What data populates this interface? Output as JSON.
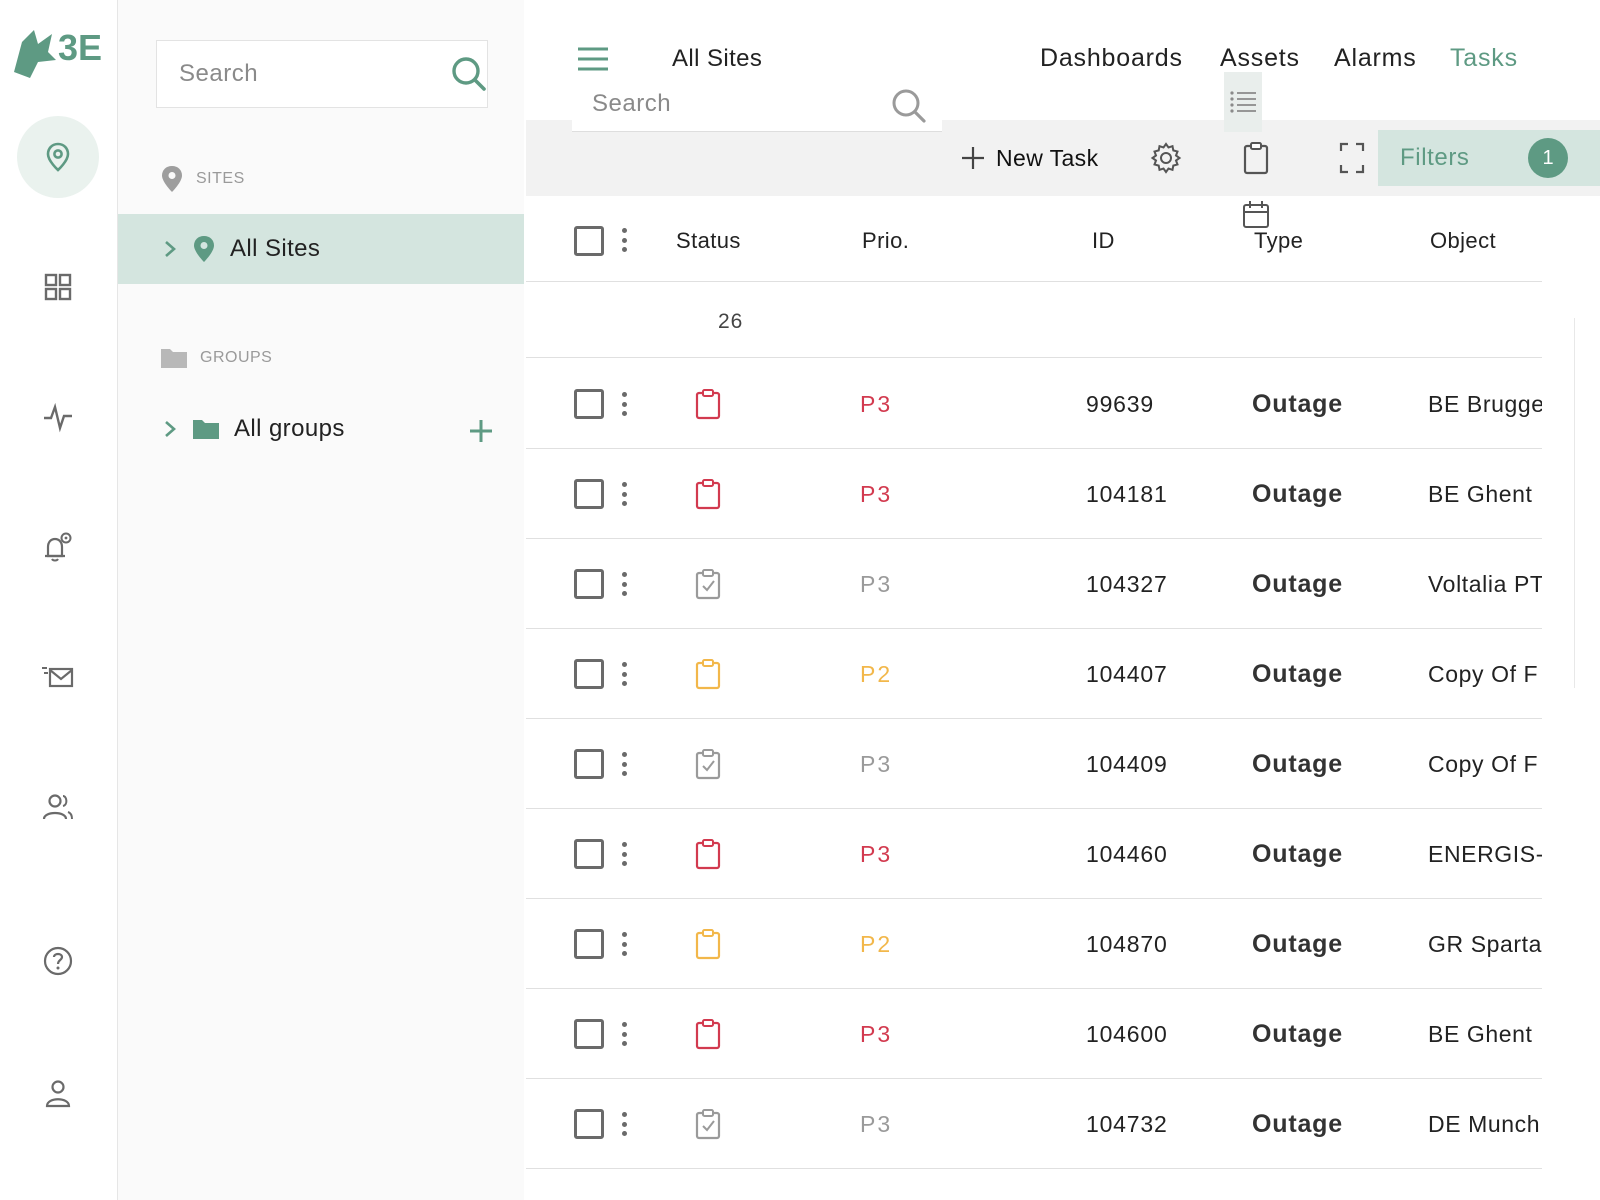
{
  "brand": {
    "logo_text": "3E",
    "color": "#5e9a83"
  },
  "rail": {
    "items": [
      {
        "name": "sites",
        "icon": "map-pin-icon",
        "active": true
      },
      {
        "name": "dashboards",
        "icon": "grid-icon"
      },
      {
        "name": "activity",
        "icon": "pulse-icon"
      },
      {
        "name": "alarm-settings",
        "icon": "bell-gear-icon"
      },
      {
        "name": "messages",
        "icon": "mail-icon"
      },
      {
        "name": "users",
        "icon": "users-icon"
      },
      {
        "name": "help",
        "icon": "help-icon"
      },
      {
        "name": "profile",
        "icon": "user-icon"
      }
    ]
  },
  "panel": {
    "search_placeholder": "Search",
    "sites_heading": "SITES",
    "all_sites_label": "All Sites",
    "groups_heading": "GROUPS",
    "all_groups_label": "All groups"
  },
  "header": {
    "breadcrumb": "All Sites",
    "nav": [
      "Dashboards",
      "Assets",
      "Alarms",
      "Tasks"
    ],
    "active_nav": "Tasks",
    "search_placeholder": "Search"
  },
  "toolbar": {
    "new_task_label": "New Task",
    "filters_label": "Filters",
    "filters_count": "1"
  },
  "table": {
    "columns": {
      "status": "Status",
      "prio": "Prio.",
      "id": "ID",
      "type": "Type",
      "object": "Object"
    },
    "count": "26",
    "rows": [
      {
        "status": "open",
        "prio": "P3",
        "id": "99639",
        "type": "Outage",
        "object": "BE Brugge"
      },
      {
        "status": "open",
        "prio": "P3",
        "id": "104181",
        "type": "Outage",
        "object": "BE Ghent"
      },
      {
        "status": "done",
        "prio": "P3",
        "id": "104327",
        "type": "Outage",
        "object": "Voltalia PT"
      },
      {
        "status": "pending",
        "prio": "P2",
        "id": "104407",
        "type": "Outage",
        "object": "Copy Of F"
      },
      {
        "status": "done",
        "prio": "P3",
        "id": "104409",
        "type": "Outage",
        "object": "Copy Of F"
      },
      {
        "status": "open",
        "prio": "P3",
        "id": "104460",
        "type": "Outage",
        "object": "ENERGIS-"
      },
      {
        "status": "pending",
        "prio": "P2",
        "id": "104870",
        "type": "Outage",
        "object": "GR Sparta"
      },
      {
        "status": "open",
        "prio": "P3",
        "id": "104600",
        "type": "Outage",
        "object": "BE Ghent"
      },
      {
        "status": "done",
        "prio": "P3",
        "id": "104732",
        "type": "Outage",
        "object": "DE Munch"
      }
    ]
  },
  "colors": {
    "open": "#d23a4f",
    "done": "#9a9a9a",
    "pending": "#f2b74a",
    "accent": "#5e9a83"
  }
}
